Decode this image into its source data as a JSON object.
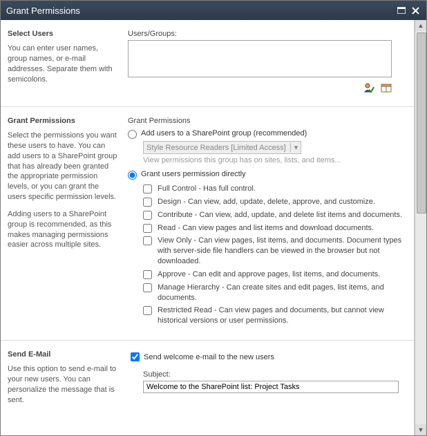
{
  "dialog": {
    "title": "Grant Permissions"
  },
  "sections": {
    "selectUsers": {
      "heading": "Select Users",
      "desc": "You can enter user names, group names, or e-mail addresses. Separate them with semicolons.",
      "fieldLabel": "Users/Groups:",
      "value": ""
    },
    "grant": {
      "heading": "Grant Permissions",
      "desc1": "Select the permissions you want these users to have. You can add users to a SharePoint group that has already been granted the appropriate permission levels, or you can grant the users specific permission levels.",
      "desc2": "Adding users to a SharePoint group is recommended, as this makes managing permissions easier across multiple sites.",
      "rightHeading": "Grant Permissions",
      "opt1": "Add users to a SharePoint group (recommended)",
      "groupSelected": "Style Resource Readers [Limited Access]",
      "groupHint": "View permissions this group has on sites, lists, and items...",
      "opt2": "Grant users permission directly",
      "perms": [
        "Full Control - Has full control.",
        "Design - Can view, add, update, delete, approve, and customize.",
        "Contribute - Can view, add, update, and delete list items and documents.",
        "Read - Can view pages and list items and download documents.",
        "View Only - Can view pages, list items, and documents. Document types with server-side file handlers can be viewed in the browser but not downloaded.",
        "Approve - Can edit and approve pages, list items, and documents.",
        "Manage Hierarchy - Can create sites and edit pages, list items, and documents.",
        "Restricted Read - Can view pages and documents, but cannot view historical versions or user permissions."
      ]
    },
    "email": {
      "heading": "Send E-Mail",
      "desc": "Use this option to send e-mail to your new users. You can personalize the message that is sent.",
      "sendLabel": "Send welcome e-mail to the new users",
      "subjectLabel": "Subject:",
      "subjectValue": "Welcome to the SharePoint list: Project Tasks"
    }
  }
}
